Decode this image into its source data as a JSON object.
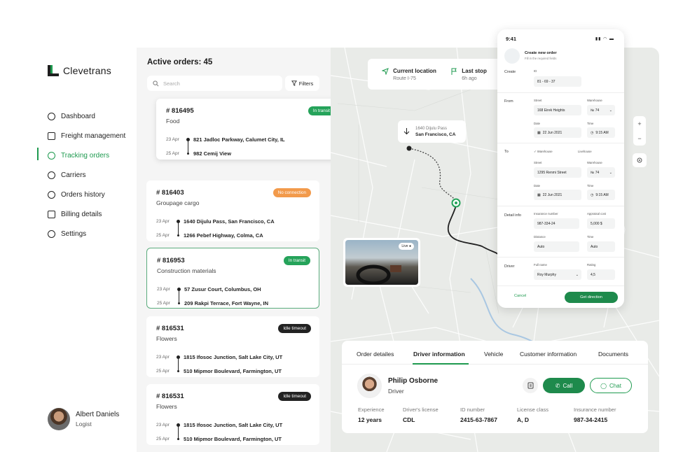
{
  "brand": {
    "name": "Clevetrans"
  },
  "nav": [
    {
      "label": "Dashboard",
      "icon": "dashboard-icon"
    },
    {
      "label": "Freight management",
      "icon": "box-icon"
    },
    {
      "label": "Tracking orders",
      "icon": "compass-icon",
      "active": true
    },
    {
      "label": "Carriers",
      "icon": "users-icon"
    },
    {
      "label": "Orders history",
      "icon": "clock-icon"
    },
    {
      "label": "Billing details",
      "icon": "card-icon"
    },
    {
      "label": "Settings",
      "icon": "gear-icon"
    }
  ],
  "user": {
    "name": "Albert Daniels",
    "role": "Logist"
  },
  "orders": {
    "title": "Active orders: 45",
    "search_placeholder": "Search",
    "filters_label": "Filters",
    "items": [
      {
        "id": "# 816495",
        "cargo": "Food",
        "status": "In transit",
        "status_color": "#25a35a",
        "from_date": "23 Apr",
        "from": "821 Jadloc Parkway, Calumet City, IL",
        "to_date": "25 Apr",
        "to": "982 Cemij View"
      },
      {
        "id": "# 816403",
        "cargo": "Groupage cargo",
        "status": "No connection",
        "status_color": "#f29a4b",
        "from_date": "23 Apr",
        "from": "1640 Dijulu Pass, San Francisco, CA",
        "to_date": "25 Apr",
        "to": "1266 Pebef Highway, Colma,  CA"
      },
      {
        "id": "# 816953",
        "cargo": "Construction materials",
        "status": "In transit",
        "status_color": "#25a35a",
        "from_date": "23 Apr",
        "from": "57 Zusur Court, Columbus, OH",
        "to_date": "25 Apr",
        "to": "209 Rakpi Terrace, Fort Wayne, IN"
      },
      {
        "id": "# 816531",
        "cargo": "Flowers",
        "status": "Idle timeout",
        "status_color": "#222222",
        "from_date": "23 Apr",
        "from": "1815 Ifosoc Junction, Salt Lake City, UT",
        "to_date": "25 Apr",
        "to": "510 Mipmor Boulevard, Farmington, UT"
      },
      {
        "id": "# 816531",
        "cargo": "Flowers",
        "status": "Idle timeout",
        "status_color": "#222222",
        "from_date": "23 Apr",
        "from": "1815 Ifosoc Junction, Salt Lake City, UT",
        "to_date": "25 Apr",
        "to": "510 Mipmor Boulevard, Farmington, UT"
      }
    ]
  },
  "map": {
    "current_location": {
      "title": "Current location",
      "sub": "Route I-75"
    },
    "last_stop": {
      "title": "Last stop",
      "sub": "6h ago"
    },
    "pass": {
      "line1": "1640 Dijulu Pass",
      "line2": "San Francisco, CA"
    },
    "live_label": "Live",
    "zoom_in": "+",
    "zoom_out": "−"
  },
  "phone": {
    "time": "9:41",
    "title": "Create new order",
    "subtitle": "Fill in the required fields",
    "sections": {
      "create": "Create",
      "from": "From",
      "to": "To",
      "detail": "Detail info",
      "driver": "Driver"
    },
    "id_label": "ID",
    "id_value": "81 - 69 - 37",
    "from": {
      "street_label": "Street",
      "street": "168 Eirek Heights",
      "wh_label": "Warehouse",
      "wh": "№ 74",
      "date_label": "Date",
      "date": "22 Jun 2021",
      "time_label": "Time",
      "time": "9:15 AM"
    },
    "to": {
      "opt1": "Warehouse",
      "opt2": "Livehouse",
      "street_label": "Street",
      "street": "1295 Renmi Street",
      "wh_label": "Warehouse",
      "wh": "№ 74",
      "date_label": "Date",
      "date": "22 Jun 2021",
      "time_label": "Time",
      "time": "9:15 AM"
    },
    "detail": {
      "ins_label": "Insurance number",
      "ins": "987-334-24",
      "cost_label": "Appraisal cost",
      "cost": "5,000 $",
      "dist_label": "Distance",
      "dist": "Auto",
      "time_label": "Time",
      "time": "Auto"
    },
    "driver": {
      "name_label": "Full name",
      "name": "Roy Murphy",
      "rating_label": "Rating",
      "rating": "4,5"
    },
    "cancel": "Cancel",
    "submit": "Get direction"
  },
  "details": {
    "tabs": [
      "Order detailes",
      "Driver information",
      "Vehicle",
      "Customer information",
      "Documents"
    ],
    "driver_name": "Philip Osborne",
    "driver_role": "Driver",
    "call": "Call",
    "chat": "Chat",
    "info": [
      {
        "k": "Experience",
        "v": "12 years"
      },
      {
        "k": "Driver's license",
        "v": "CDL"
      },
      {
        "k": "ID number",
        "v": "2415-63-7867"
      },
      {
        "k": "License class",
        "v": "A, D"
      },
      {
        "k": "Insurance number",
        "v": "987-34-2415"
      }
    ]
  },
  "colors": {
    "accent": "#1e9a4f",
    "orange": "#f29a4b",
    "dark": "#222222"
  }
}
